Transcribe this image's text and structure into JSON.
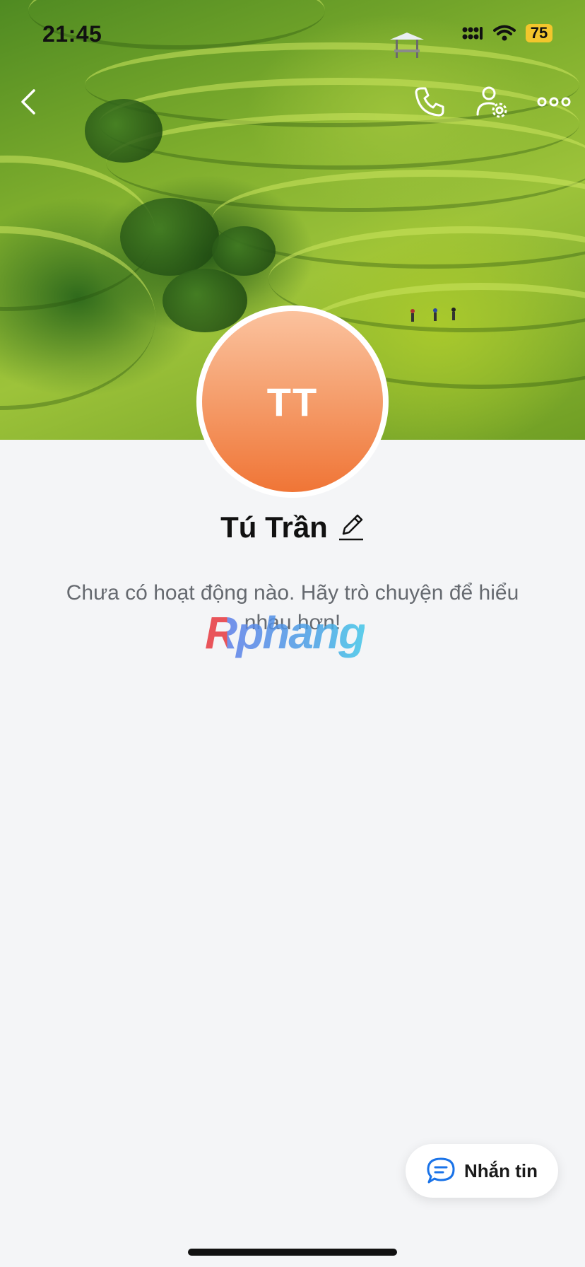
{
  "status_bar": {
    "time": "21:45",
    "battery": "75",
    "icons": [
      "signal-icon",
      "wifi-icon",
      "battery-icon"
    ]
  },
  "header": {
    "icons": [
      "back-chevron-icon",
      "phone-icon",
      "user-settings-icon",
      "more-icon"
    ]
  },
  "profile": {
    "initials": "TT",
    "name": "Tú Trần",
    "empty_message": "Chưa có hoạt động nào. Hãy trò chuyện để hiểu nhau hơn!",
    "avatar_colors": [
      "#fbc29e",
      "#f07536"
    ]
  },
  "watermark": {
    "text": "Rphang"
  },
  "fab": {
    "label": "Nhắn tin",
    "icon": "chat-bubble-icon",
    "accent": "#1a73e8"
  }
}
